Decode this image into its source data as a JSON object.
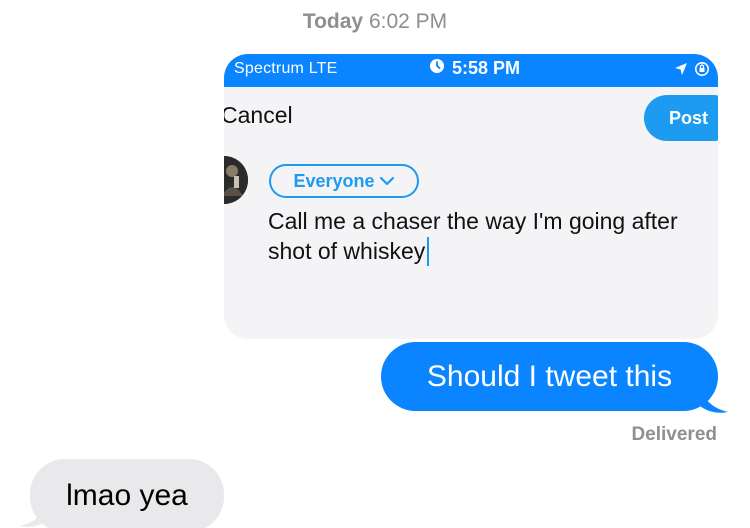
{
  "conversation": {
    "timestamp_day": "Today",
    "timestamp_time": "6:02 PM",
    "outgoing_message": "Should I tweet this",
    "delivery_status": "Delivered",
    "incoming_message": "lmao yea",
    "colors": {
      "outgoing_bubble": "#0a84ff",
      "incoming_bubble": "#e9e9eb",
      "meta_text": "#8e8e93"
    }
  },
  "attachment": {
    "status_bar": {
      "carrier": "Spectrum  LTE",
      "time": "5:58 PM",
      "icons": [
        "clock-icon",
        "location-arrow-icon",
        "orientation-lock-icon"
      ]
    },
    "compose": {
      "cancel_label": "Cancel",
      "post_label": "Post",
      "audience_label": "Everyone",
      "text_line1": "Call me a chaser the way I'm going after",
      "text_line2": "shot of whiskey"
    },
    "colors": {
      "status_bar": "#0a84ff",
      "accent": "#1d9bf0"
    }
  }
}
